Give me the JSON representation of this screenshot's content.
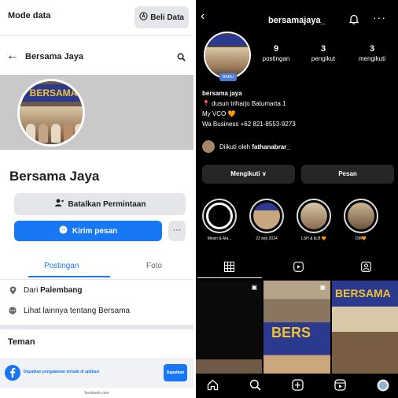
{
  "facebook": {
    "mode_label": "Mode data",
    "beli_data_label": "Beli Data",
    "page_title": "Bersama Jaya",
    "cover_banner_text": "BERSAMA",
    "profile_name": "Bersama Jaya",
    "batalkan_label": "Batalkan Permintaan",
    "kirim_label": "Kirim pesan",
    "more_label": "···",
    "tabs": [
      {
        "label": "Postingan",
        "active": true
      },
      {
        "label": "Foto",
        "active": false
      }
    ],
    "from_prefix": "Dari ",
    "from_city": "Palembang",
    "see_more": "Lihat lainnya tentang Bersama",
    "friends_heading": "Teman",
    "app_banner_text": "Dapatkan pengalaman terbaik di aplikasi",
    "app_banner_button": "Dapatkan",
    "url_text": "facebook.com"
  },
  "instagram": {
    "username": "bersamajaya_",
    "new_badge": "BARU",
    "stats": [
      {
        "num": "9",
        "label": "postingan"
      },
      {
        "num": "3",
        "label": "pengikut"
      },
      {
        "num": "3",
        "label": "mengikuti"
      }
    ],
    "bio_name": "bersama jaya",
    "bio_lines": [
      "📍 dusun triharjo Batumarta 1",
      "My VCO 🧡",
      "Wa Business +62 821-8553-9273"
    ],
    "followed_prefix": "Diikuti oleh ",
    "followed_by": "fathanabrar_",
    "following_button": "Mengikuti ∨",
    "message_button": "Pesan",
    "highlights": [
      {
        "label": "Mesin & Ala..."
      },
      {
        "label": "22 sep 2024"
      },
      {
        "label": "LSH & kLB 🧡"
      },
      {
        "label": "DM🧡"
      }
    ],
    "grid_texts": [
      "BERSAMA",
      "BERS",
      "BERSAMA"
    ]
  },
  "colors": {
    "fb_blue": "#1877f2",
    "ig_bg": "#000000",
    "ig_button": "#262626"
  }
}
